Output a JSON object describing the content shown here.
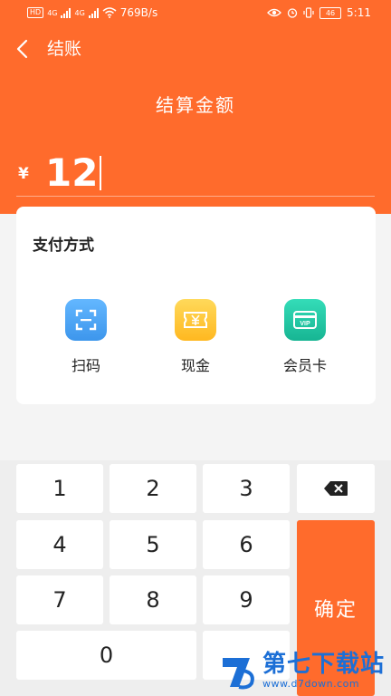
{
  "status_bar": {
    "left_tags": [
      "HD",
      "4G",
      "4G"
    ],
    "speed": "769B/s",
    "battery": "46",
    "time": "5:11"
  },
  "header": {
    "title": "结账",
    "amount_label": "结算金额",
    "currency": "¥",
    "amount": "12"
  },
  "payment": {
    "title": "支付方式",
    "methods": [
      {
        "label": "扫码",
        "icon": "scan-icon",
        "color": "#4aa7f5"
      },
      {
        "label": "现金",
        "icon": "cash-icon",
        "color": "#ffc636"
      },
      {
        "label": "会员卡",
        "icon": "vip-card-icon",
        "color": "#22c8a6"
      }
    ]
  },
  "keypad": {
    "keys": [
      "1",
      "2",
      "3",
      "4",
      "5",
      "6",
      "7",
      "8",
      "9",
      "0"
    ],
    "confirm": "确定",
    "backspace_icon": "backspace-icon"
  },
  "watermark": {
    "name": "第七下载站",
    "url": "www.d7down.com"
  },
  "colors": {
    "accent": "#ff6b2c",
    "background": "#f4f4f4"
  }
}
